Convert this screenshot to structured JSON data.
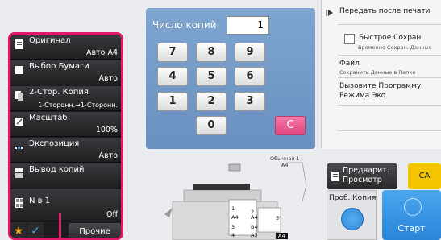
{
  "left_panel": {
    "items": [
      {
        "label": "Оригинал",
        "value": "Авто  A4",
        "icon": "original-icon"
      },
      {
        "label": "Выбор Бумаги",
        "value": "Авто",
        "icon": "paper-select-icon"
      },
      {
        "label": "2-Стор. Копия",
        "value": "1-Сторонн.→1-Сторонн.",
        "icon": "duplex-icon"
      },
      {
        "label": "Масштаб",
        "value": "100%",
        "icon": "zoom-icon"
      },
      {
        "label": "Экспозиция",
        "value": "Авто",
        "icon": "exposure-icon"
      },
      {
        "label": "Вывод копий",
        "value": "",
        "icon": "output-icon"
      },
      {
        "label": "N в 1",
        "value": "Off",
        "icon": "n-up-icon"
      }
    ],
    "other_label": "Прочие"
  },
  "keypad": {
    "copies_label": "Число копий",
    "copies_value": "1",
    "keys": [
      "7",
      "8",
      "9",
      "4",
      "5",
      "6",
      "1",
      "2",
      "3",
      "0"
    ],
    "clear_label": "C"
  },
  "right_panel": {
    "send_after_print": "Передать после печати",
    "quick_save": "Быстрое Сохран",
    "quick_save_sub": "Временно Сохран. Данные",
    "file_label": "Файл",
    "file_sub": "Сохранить Данные в Папке",
    "eco_label_1": "Вызовите Программу",
    "eco_label_2": "Режима Эко"
  },
  "paper": {
    "normal_label": "Обычная 1",
    "normal_size": "A4"
  },
  "trays": [
    {
      "num": "1",
      "size": "A4"
    },
    {
      "num": "2",
      "size": "A4"
    },
    {
      "num": "3",
      "size": "B4"
    },
    {
      "num": "4",
      "size": "A3"
    },
    {
      "num": "5",
      "size": "A4"
    }
  ],
  "buttons": {
    "preview_1": "Предварит.",
    "preview_2": "Просмотр",
    "ca": "CA",
    "trial_copy": "Проб. Копия",
    "start": "Старт"
  },
  "colors": {
    "accent": "#e2196b",
    "keypad_bg": "#7ea4d0",
    "start_blue": "#2f86d6",
    "ca_yellow": "#f5c400"
  }
}
